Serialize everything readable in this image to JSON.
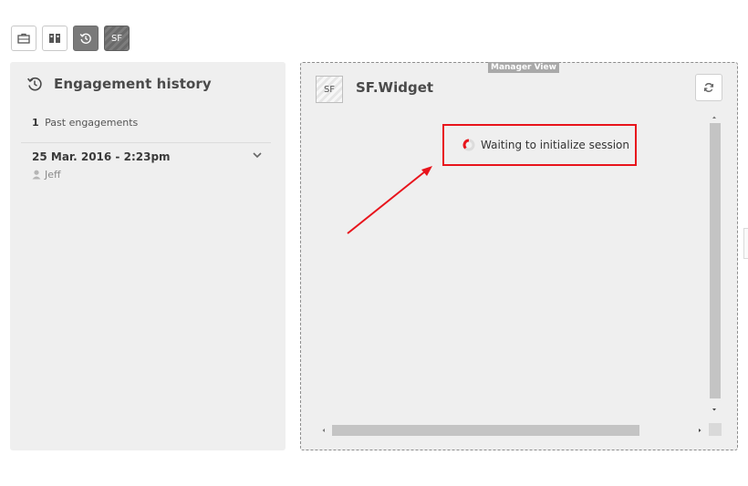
{
  "toolbar": {
    "buttons": [
      {
        "icon": "briefcase-icon"
      },
      {
        "icon": "team-icon"
      },
      {
        "icon": "history-icon",
        "active": true
      },
      {
        "icon": "sf-widget-icon",
        "label": "SF"
      }
    ]
  },
  "history": {
    "title": "Engagement history",
    "past_count": "1",
    "past_label": "Past engagements",
    "engagements": [
      {
        "date": "25 Mar. 2016 - 2:23pm",
        "agent": "Jeff"
      }
    ]
  },
  "widget": {
    "badge": "Manager View",
    "icon_label": "SF",
    "title": "SF.Widget",
    "status": "Waiting to initialize session"
  },
  "colors": {
    "panel_bg": "#efefef",
    "highlight": "#e8141c",
    "spinner": "#e8141c"
  }
}
